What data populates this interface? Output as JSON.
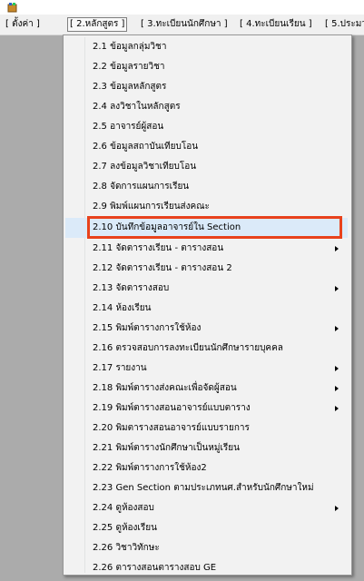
{
  "menubar": {
    "items": [
      {
        "label": "[ ตั้งค่า ]"
      },
      {
        "label": "[ 2.หลักสูตร ]"
      },
      {
        "label": "[ 3.ทะเบียนนักศึกษา ]"
      },
      {
        "label": "[ 4.ทะเบียนเรียน ]"
      },
      {
        "label": "[ 5.ประมว"
      }
    ]
  },
  "menu": {
    "items": [
      {
        "label": "2.1 ข้อมูลกลุ่มวิชา"
      },
      {
        "label": "2.2 ข้อมูลรายวิชา"
      },
      {
        "label": "2.3 ข้อมูลหลักสูตร"
      },
      {
        "label": "2.4 ลงวิชาในหลักสูตร"
      },
      {
        "label": "2.5 อาจารย์ผู้สอน"
      },
      {
        "label": "2.6 ข้อมูลสถาบันเทียบโอน"
      },
      {
        "label": "2.7 ลงข้อมูลวิชาเทียบโอน"
      },
      {
        "label": "2.8 จัดการแผนการเรียน"
      },
      {
        "label": "2.9 พิมพ์แผนการเรียนส่งคณะ"
      },
      {
        "label": "2.10 บันทึกข้อมูลอาจารย์ใน Section"
      },
      {
        "label": "2.11 จัดตารางเรียน - ตารางสอน"
      },
      {
        "label": "2.12 จัดตารางเรียน - ตารางสอน 2"
      },
      {
        "label": "2.13 จัดตารางสอบ"
      },
      {
        "label": "2.14 ห้องเรียน"
      },
      {
        "label": "2.15 พิมพ์ตารางการใช้ห้อง"
      },
      {
        "label": "2.16 ตรวจสอบการลงทะเบียนนักศึกษารายบุคคล"
      },
      {
        "label": "2.17 รายงาน"
      },
      {
        "label": "2.18 พิมพ์ตารางส่งคณะเพื่อจัดผู้สอน"
      },
      {
        "label": "2.19 พิมพ์ตารางสอนอาจารย์แบบตาราง"
      },
      {
        "label": "2.20 พิมตารางสอนอาจารย์แบบรายการ"
      },
      {
        "label": "2.21 พิมพ์ตารางนักศึกษาเป็นหมู่เรียน"
      },
      {
        "label": "2.22 พิมพ์ตารางการใช้ห้อง2"
      },
      {
        "label": "2.23 Gen Section ตามประเภทนศ.สำหรับนักศึกษาใหม่"
      },
      {
        "label": "2.24 ดูห้องสอบ"
      },
      {
        "label": "2.25 ดูห้องเรียน"
      },
      {
        "label": "2.26 วิชาวิทักษะ"
      },
      {
        "label": "2.26 ตารางสอนตารางสอบ GE"
      }
    ]
  },
  "colors": {
    "workspace": "#ababab",
    "menu_bg": "#f2f2f2",
    "highlight": "#dbeaf9",
    "callout": "#e8421c"
  },
  "icons": {
    "app": "app-icon",
    "submenu": "submenu-arrow-icon"
  }
}
